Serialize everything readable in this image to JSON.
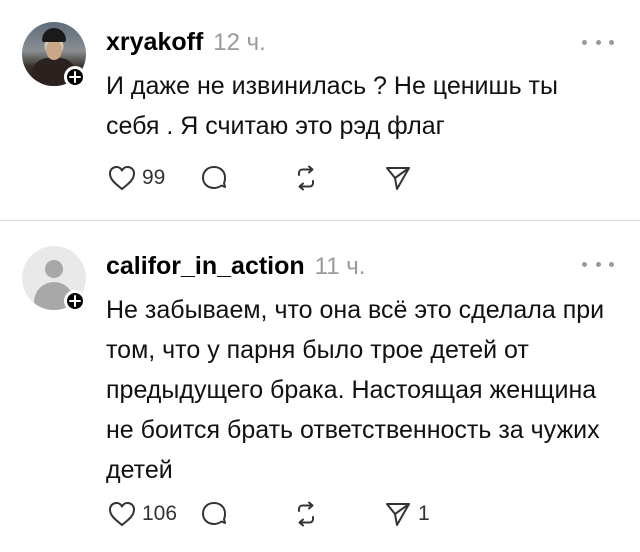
{
  "posts": [
    {
      "username": "xryakoff",
      "time": "12 ч.",
      "text": "И даже не извинилась ? Не ценишь ты себя . Я считаю это рэд флаг",
      "likes": "99",
      "comments": "",
      "reposts": "",
      "shares": "",
      "avatar": "photo"
    },
    {
      "username": "califor_in_action",
      "time": "11 ч.",
      "text": "Не забываем, что она всё это сделала при том, что у парня было трое детей от предыдущего брака. Настоящая женщина не боится брать ответственность за чужих детей",
      "likes": "106",
      "comments": "",
      "reposts": "",
      "shares": "1",
      "avatar": "default"
    }
  ],
  "icons": {
    "like": "heart-icon",
    "comment": "comment-bubble-icon",
    "repost": "repost-icon",
    "share": "send-icon",
    "more": "more-dots-icon",
    "follow": "plus-icon"
  },
  "colors": {
    "text": "#111111",
    "muted": "#9a9a9a",
    "divider": "#dcdcdc",
    "badge": "#000000"
  }
}
